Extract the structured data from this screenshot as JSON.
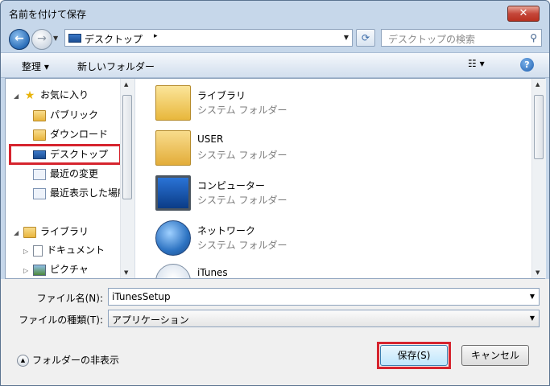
{
  "window": {
    "title": "名前を付けて保存",
    "close": "✕"
  },
  "address": {
    "path": "デスクトップ",
    "separator": "▸"
  },
  "search": {
    "placeholder": "デスクトップの検索"
  },
  "toolbar": {
    "organize": "整理 ▾",
    "new_folder": "新しいフォルダー",
    "help": "?"
  },
  "nav": {
    "favorites": "お気に入り",
    "items": [
      "パブリック",
      "ダウンロード",
      "デスクトップ",
      "最近の変更",
      "最近表示した場所"
    ],
    "library": "ライブラリ",
    "lib_items": [
      "ドキュメント",
      "ピクチャ"
    ],
    "selected": "デスクトップ"
  },
  "files": [
    {
      "name": "ライブラリ",
      "type": "システム フォルダー",
      "icon": "library-icon"
    },
    {
      "name": "USER",
      "type": "システム フォルダー",
      "icon": "user-folder-icon"
    },
    {
      "name": "コンピューター",
      "type": "システム フォルダー",
      "icon": "computer-icon"
    },
    {
      "name": "ネットワーク",
      "type": "システム フォルダー",
      "icon": "network-icon"
    },
    {
      "name": "iTunes",
      "type": "",
      "icon": "itunes-icon"
    }
  ],
  "form": {
    "filename_label": "ファイル名(N):",
    "filename_value": "iTunesSetup",
    "filetype_label": "ファイルの種類(T):",
    "filetype_value": "アプリケーション"
  },
  "footer": {
    "hide_folders": "フォルダーの非表示",
    "save": "保存(S)",
    "cancel": "キャンセル"
  },
  "colors": {
    "highlight": "#d6242e",
    "accent": "#3c7fb1"
  }
}
